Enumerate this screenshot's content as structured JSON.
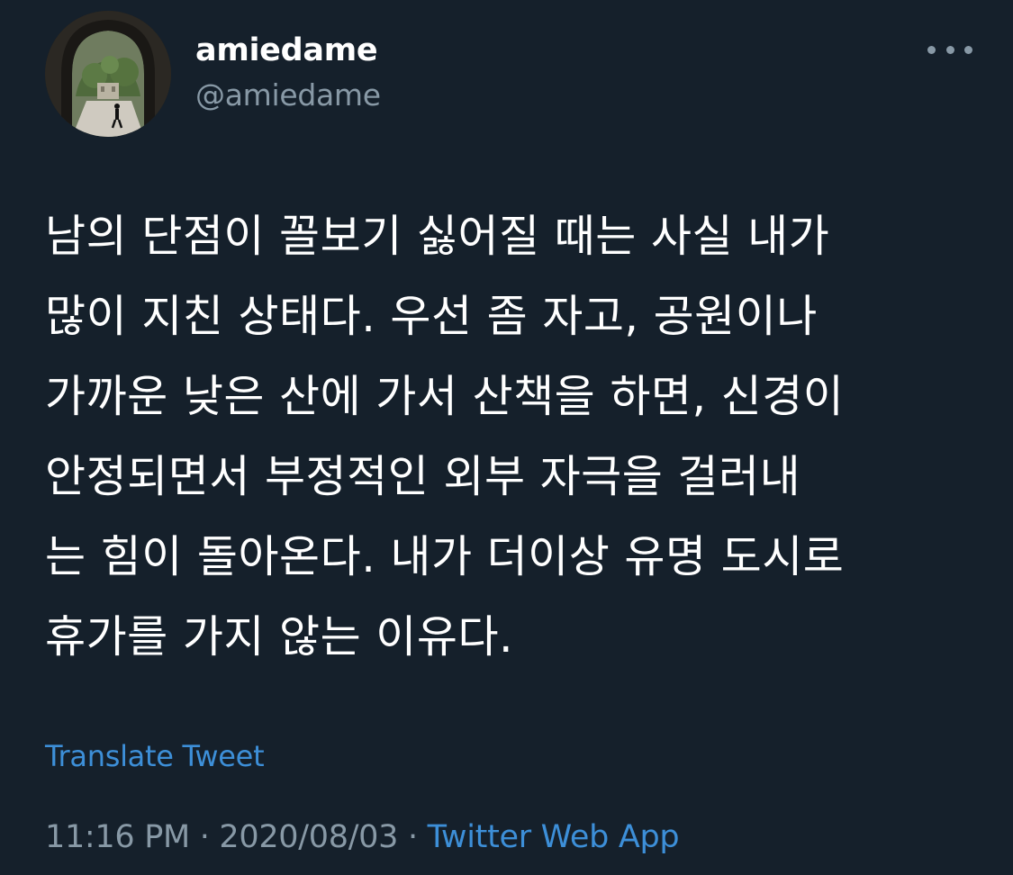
{
  "user": {
    "display_name": "amiedame",
    "handle": "@amiedame"
  },
  "tweet": {
    "lines": [
      "남의 단점이 꼴보기 싫어질 때는 사실 내가",
      "많이 지친 상태다. 우선 좀 자고, 공원이나",
      "가까운 낮은 산에 가서 산책을 하면, 신경이",
      "안정되면서 부정적인 외부 자극을 걸러내",
      "는 힘이 돌아온다. 내가 더이상 유명 도시로",
      "휴가를 가지 않는 이유다."
    ],
    "translate_label": "Translate Tweet",
    "time": "11:16 PM",
    "separator": "·",
    "date": "2020/08/03",
    "source": "Twitter Web App"
  },
  "icons": {
    "more": "more-horizontal-icon",
    "avatar": "avatar-archway-photo"
  },
  "colors": {
    "background": "#15202b",
    "text": "#ffffff",
    "secondary": "#8899a6",
    "link": "#3d8fd8"
  }
}
